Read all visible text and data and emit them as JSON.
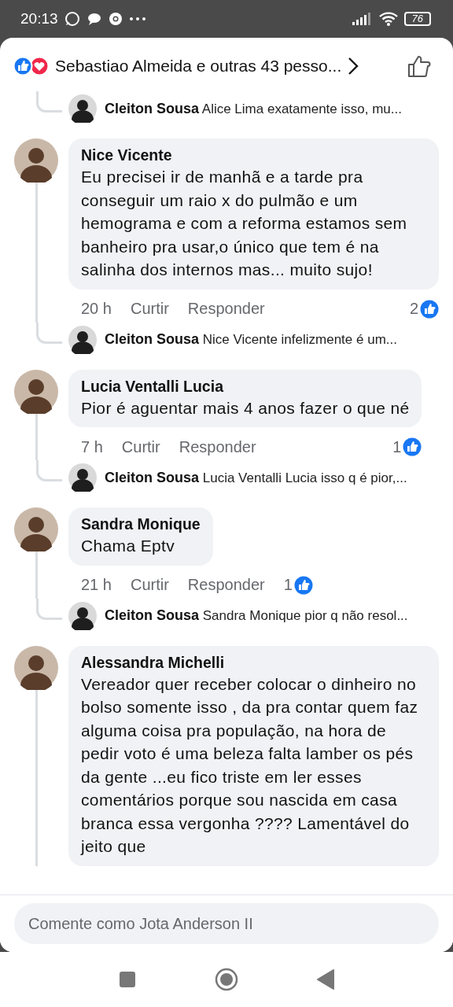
{
  "status_bar": {
    "time": "20:13",
    "battery": "76"
  },
  "header": {
    "reactions_text": "Sebastiao Almeida e outras 43 pesso..."
  },
  "items": [
    {
      "kind": "reply",
      "author": "Cleiton Sousa",
      "text": "Alice Lima exatamente isso, mu..."
    },
    {
      "kind": "comment",
      "author": "Nice Vicente",
      "text": "Eu precisei ir de manhã e a tarde pra conseguir um raio x do pulmão e um hemograma e com a reforma estamos sem banheiro pra usar,o único que tem é na salinha dos internos mas... muito sujo!",
      "time": "20 h",
      "like_label": "Curtir",
      "reply_label": "Responder",
      "reactions": "2"
    },
    {
      "kind": "reply",
      "author": "Cleiton Sousa",
      "text": "Nice Vicente infelizmente é um..."
    },
    {
      "kind": "comment",
      "author": "Lucia Ventalli Lucia",
      "text": "Pior é aguentar mais 4 anos fazer o que né",
      "time": "7 h",
      "like_label": "Curtir",
      "reply_label": "Responder",
      "reactions": "1"
    },
    {
      "kind": "reply",
      "author": "Cleiton Sousa",
      "text": "Lucia Ventalli Lucia isso q é pior,..."
    },
    {
      "kind": "comment",
      "author": "Sandra Monique",
      "text": "Chama Eptv",
      "time": "21 h",
      "like_label": "Curtir",
      "reply_label": "Responder",
      "reactions": "1"
    },
    {
      "kind": "reply",
      "author": "Cleiton Sousa",
      "text": "Sandra Monique pior q não resol..."
    },
    {
      "kind": "comment",
      "author": "Alessandra Michelli",
      "text": "Vereador quer receber colocar o dinheiro no bolso somente isso , da pra contar quem faz alguma coisa pra população, na hora de pedir voto é uma beleza falta lamber os pés da gente ...eu fico triste em ler esses comentários porque sou nascida em casa branca essa vergonha ???? Lamentável do jeito que"
    }
  ],
  "composer": {
    "placeholder": "Comente como Jota Anderson II"
  }
}
